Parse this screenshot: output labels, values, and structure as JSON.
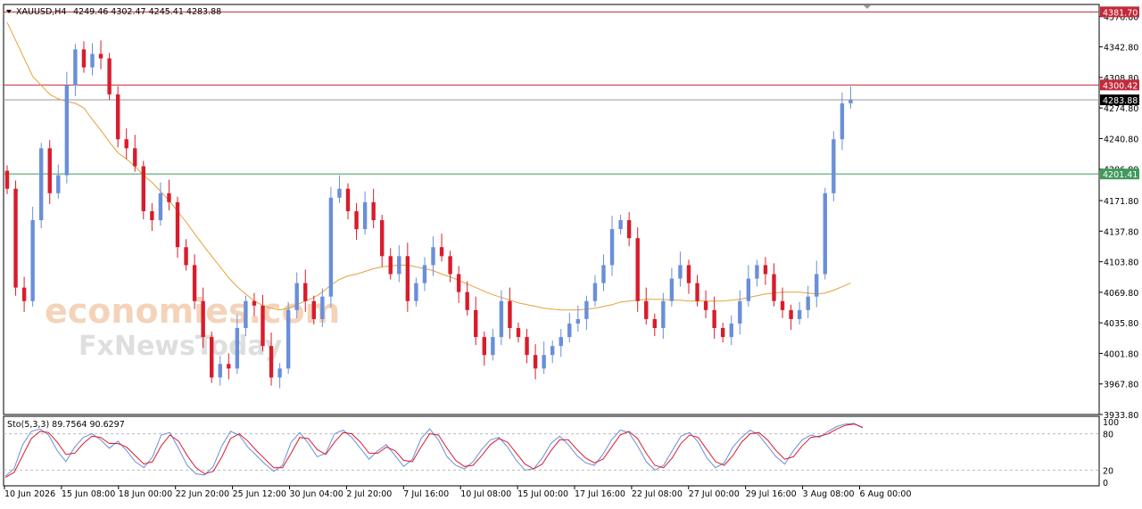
{
  "header": {
    "symbol": "XAUUSD,H4",
    "ohlc": "4249.46 4302.47 4245.41 4283.88"
  },
  "watermark": {
    "line1": "economies.com",
    "line2": "FxNewsToday"
  },
  "colors": {
    "bull": "#6a8fd8",
    "bear": "#d91c2c",
    "ma": "#e3a23a",
    "resistance": "#c22a3a",
    "support": "#3f9a5c",
    "current_price": "#000000",
    "stoch_main": "#6a8fd8",
    "stoch_signal": "#d91c2c"
  },
  "chart_data": [
    {
      "type": "candlestick",
      "title": "XAUUSD,H4",
      "ylim": [
        3933.8,
        4390
      ],
      "y_ticks": [
        "4376.80",
        "4342.80",
        "4308.80",
        "4274.80",
        "4240.80",
        "4206.80",
        "4171.80",
        "4137.80",
        "4103.80",
        "4069.80",
        "4035.80",
        "4001.80",
        "3967.80",
        "3933.80"
      ],
      "x_ticks": [
        "10 Jun 2026",
        "15 Jun 08:00",
        "18 Jun 00:00",
        "22 Jun 20:00",
        "25 Jun 12:00",
        "30 Jun 04:00",
        "2 Jul 20:00",
        "7 Jul 16:00",
        "10 Jul 08:00",
        "15 Jul 00:00",
        "17 Jul 16:00",
        "22 Jul 08:00",
        "27 Jul 00:00",
        "29 Jul 16:00",
        "3 Aug 08:00",
        "6 Aug 00:00"
      ],
      "price_levels": [
        {
          "label": "4381.70",
          "value": 4381.7,
          "kind": "resistance"
        },
        {
          "label": "4300.42",
          "value": 4300.42,
          "kind": "resistance"
        },
        {
          "label": "4283.88",
          "value": 4283.88,
          "kind": "current"
        },
        {
          "label": "4201.41",
          "value": 4201.41,
          "kind": "support"
        }
      ],
      "series": [
        {
          "name": "XAUUSD close",
          "values": [
            4185,
            4075,
            4060,
            4150,
            4230,
            4180,
            4200,
            4300,
            4340,
            4320,
            4335,
            4330,
            4290,
            4240,
            4230,
            4210,
            4160,
            4150,
            4180,
            4170,
            4120,
            4100,
            4060,
            4020,
            3975,
            3990,
            3985,
            4030,
            4060,
            4055,
            4010,
            3975,
            3985,
            4050,
            4080,
            4060,
            4040,
            4065,
            4175,
            4185,
            4160,
            4140,
            4170,
            4150,
            4110,
            4090,
            4110,
            4060,
            4080,
            4100,
            4120,
            4110,
            4090,
            4070,
            4050,
            4020,
            4000,
            4020,
            4060,
            4030,
            4020,
            4000,
            3985,
            4000,
            4010,
            4020,
            4035,
            4040,
            4060,
            4080,
            4100,
            4140,
            4150,
            4130,
            4060,
            4040,
            4030,
            4060,
            4085,
            4100,
            4080,
            4060,
            4050,
            4030,
            4020,
            4035,
            4060,
            4085,
            4100,
            4090,
            4060,
            4050,
            4040,
            4050,
            4065,
            4090,
            4180,
            4240,
            4280,
            4283.88
          ]
        },
        {
          "name": "",
          "values": [
            4370,
            4350,
            4330,
            4310,
            4300,
            4290,
            4285,
            4282,
            4280,
            4275,
            4262,
            4250,
            4237,
            4225,
            4218,
            4210,
            4200,
            4192,
            4182,
            4172,
            4160,
            4148,
            4135,
            4122,
            4110,
            4098,
            4086,
            4076,
            4068,
            4060,
            4055,
            4052,
            4050,
            4052,
            4056,
            4060,
            4064,
            4070,
            4078,
            4084,
            4088,
            4090,
            4093,
            4096,
            4098,
            4099,
            4100,
            4100,
            4098,
            4096,
            4094,
            4090,
            4087,
            4083,
            4079,
            4075,
            4071,
            4067,
            4064,
            4061,
            4058,
            4056,
            4054,
            4052,
            4051,
            4050,
            4050,
            4050,
            4051,
            4052,
            4054,
            4056,
            4059,
            4060,
            4061,
            4062,
            4062,
            4062,
            4061,
            4061,
            4060,
            4060,
            4060,
            4060,
            4060,
            4061,
            4062,
            4064,
            4066,
            4068,
            4069,
            4070,
            4070,
            4070,
            4069,
            4068,
            4069,
            4072,
            4076,
            4080
          ]
        }
      ]
    },
    {
      "type": "line",
      "title": "Sto(5,3,3) 89.7564 90.6297",
      "ylim": [
        0,
        100
      ],
      "y_ticks": [
        "100",
        "80",
        "20",
        "0"
      ],
      "levels": [
        80,
        20
      ],
      "series": [
        {
          "name": "",
          "values": [
            10,
            22,
            62,
            84,
            88,
            78,
            52,
            34,
            58,
            74,
            80,
            70,
            56,
            68,
            52,
            34,
            24,
            42,
            78,
            82,
            56,
            28,
            14,
            12,
            26,
            60,
            84,
            78,
            58,
            44,
            30,
            18,
            28,
            66,
            82,
            64,
            42,
            48,
            80,
            86,
            74,
            56,
            38,
            52,
            62,
            44,
            26,
            38,
            72,
            88,
            70,
            42,
            28,
            22,
            34,
            54,
            70,
            74,
            58,
            36,
            20,
            22,
            40,
            64,
            76,
            62,
            44,
            32,
            28,
            46,
            70,
            86,
            82,
            60,
            34,
            20,
            28,
            52,
            76,
            82,
            66,
            40,
            24,
            32,
            58,
            74,
            86,
            78,
            60,
            42,
            30,
            52,
            70,
            78,
            74,
            84,
            92,
            96,
            97,
            89.7564
          ]
        },
        {
          "name": "",
          "values": [
            8,
            16,
            44,
            72,
            84,
            82,
            66,
            46,
            48,
            64,
            76,
            74,
            64,
            64,
            58,
            44,
            30,
            34,
            60,
            78,
            68,
            44,
            24,
            14,
            18,
            42,
            72,
            80,
            68,
            52,
            38,
            24,
            24,
            48,
            74,
            72,
            54,
            46,
            66,
            82,
            80,
            66,
            48,
            48,
            58,
            52,
            36,
            34,
            58,
            80,
            78,
            56,
            36,
            26,
            28,
            44,
            62,
            72,
            66,
            48,
            30,
            22,
            30,
            52,
            70,
            70,
            54,
            40,
            32,
            38,
            58,
            78,
            84,
            72,
            48,
            28,
            24,
            40,
            64,
            78,
            74,
            54,
            34,
            28,
            44,
            66,
            80,
            82,
            70,
            52,
            38,
            42,
            60,
            74,
            76,
            80,
            88,
            94,
            96,
            90.6297
          ]
        }
      ]
    }
  ]
}
